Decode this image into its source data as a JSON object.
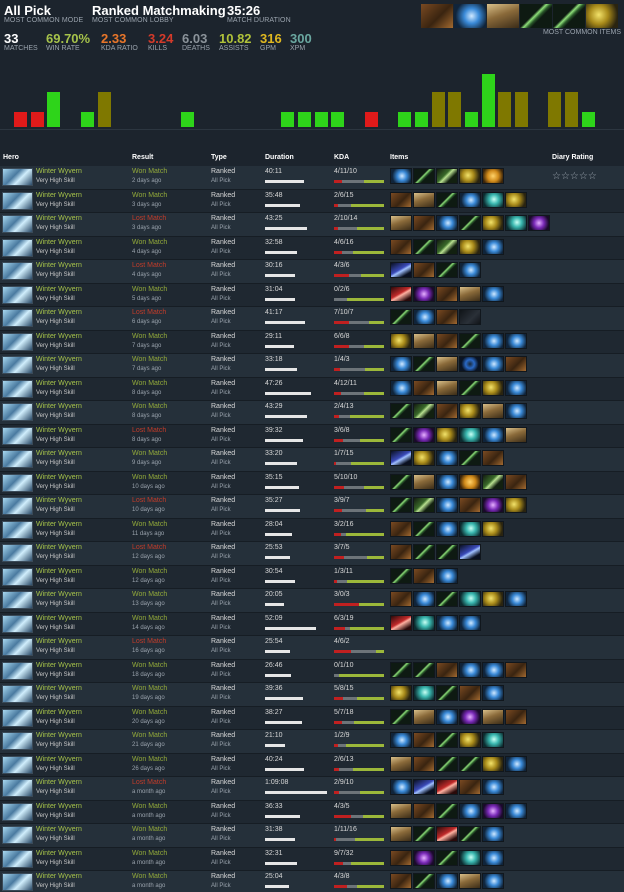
{
  "header": {
    "mode_value": "All Pick",
    "mode_caption": "MOST COMMON MODE",
    "lobby_value": "Ranked Matchmaking",
    "lobby_caption": "MOST COMMON LOBBY",
    "duration_value": "35:26",
    "duration_caption": "MATCH DURATION",
    "stats": [
      {
        "value": "33",
        "caption": "MATCHES",
        "color": "#ffffff"
      },
      {
        "value": "69.70%",
        "caption": "WIN RATE",
        "color": "#a6c34a"
      },
      {
        "value": "2.33",
        "caption": "KDA RATIO",
        "color": "#e8762a"
      },
      {
        "value": "3.24",
        "caption": "KILLS",
        "color": "#d43a2a"
      },
      {
        "value": "6.03",
        "caption": "DEATHS",
        "color": "#8b939a"
      },
      {
        "value": "10.82",
        "caption": "ASSISTS",
        "color": "#b0c23a"
      },
      {
        "value": "316",
        "caption": "GPM",
        "color": "#e0b820"
      },
      {
        "value": "300",
        "caption": "XPM",
        "color": "#6aa7a0"
      }
    ],
    "common_items_caption": "MOST COMMON ITEMS",
    "common_items": [
      "boots-icon",
      "orb-icon",
      "scroll-icon",
      "staff-icon",
      "staff-icon",
      "hammer-icon"
    ]
  },
  "graph": {
    "colors": {
      "win": "#2ed41a",
      "loss": "#e01a1a",
      "neutral": "#7f7800"
    },
    "bars": [
      {
        "level": 0.25,
        "kind": "loss"
      },
      {
        "level": 0.25,
        "kind": "loss"
      },
      {
        "level": 0.58,
        "kind": "win"
      },
      {
        "level": 0,
        "kind": "none"
      },
      {
        "level": 0.25,
        "kind": "win"
      },
      {
        "level": 0.58,
        "kind": "neutral"
      },
      {
        "level": 0,
        "kind": "none"
      },
      {
        "level": 0,
        "kind": "none"
      },
      {
        "level": 0,
        "kind": "none"
      },
      {
        "level": 0,
        "kind": "none"
      },
      {
        "level": 0.25,
        "kind": "win"
      },
      {
        "level": 0,
        "kind": "none"
      },
      {
        "level": 0,
        "kind": "none"
      },
      {
        "level": 0,
        "kind": "none"
      },
      {
        "level": 0,
        "kind": "none"
      },
      {
        "level": 0,
        "kind": "none"
      },
      {
        "level": 0.25,
        "kind": "win"
      },
      {
        "level": 0.25,
        "kind": "win"
      },
      {
        "level": 0.25,
        "kind": "win"
      },
      {
        "level": 0.25,
        "kind": "win"
      },
      {
        "level": 0,
        "kind": "none"
      },
      {
        "level": 0.25,
        "kind": "loss"
      },
      {
        "level": 0,
        "kind": "none"
      },
      {
        "level": 0.25,
        "kind": "win"
      },
      {
        "level": 0.25,
        "kind": "win"
      },
      {
        "level": 0.58,
        "kind": "neutral"
      },
      {
        "level": 0.58,
        "kind": "neutral"
      },
      {
        "level": 0.25,
        "kind": "win"
      },
      {
        "level": 0.88,
        "kind": "win"
      },
      {
        "level": 0.58,
        "kind": "neutral"
      },
      {
        "level": 0.58,
        "kind": "neutral"
      },
      {
        "level": 0,
        "kind": "none"
      },
      {
        "level": 0.58,
        "kind": "neutral"
      },
      {
        "level": 0.58,
        "kind": "neutral"
      },
      {
        "level": 0.25,
        "kind": "win"
      }
    ]
  },
  "columns": {
    "hero": "Hero",
    "result": "Result",
    "type": "Type",
    "duration": "Duration",
    "kda": "KDA",
    "items": "Items",
    "rating": "Diary Rating"
  },
  "rating_stars": "☆☆☆☆☆",
  "matches": [
    {
      "hero": "Winter Wyvern",
      "skill": "Very High Skill",
      "result": "Won Match",
      "win": true,
      "ago": "2 days ago",
      "type": "Ranked",
      "mode": "All Pick",
      "duration": "40:11",
      "dur_frac": 0.63,
      "kda": "4/11/10",
      "k": 4,
      "d": 11,
      "a": 10,
      "items": [
        "orb-icon",
        "staff-icon",
        "branch-icon",
        "hammer-icon",
        "gold-icon"
      ]
    },
    {
      "hero": "Winter Wyvern",
      "skill": "Very High Skill",
      "result": "Won Match",
      "win": true,
      "ago": "3 days ago",
      "type": "Ranked",
      "mode": "All Pick",
      "duration": "35:48",
      "dur_frac": 0.56,
      "kda": "2/6/15",
      "k": 2,
      "d": 6,
      "a": 15,
      "items": [
        "boots-icon",
        "scroll-icon",
        "staff-icon",
        "orb-icon",
        "cyclone-icon",
        "hammer-icon"
      ]
    },
    {
      "hero": "Winter Wyvern",
      "skill": "Very High Skill",
      "result": "Lost Match",
      "win": false,
      "ago": "3 days ago",
      "type": "Ranked",
      "mode": "All Pick",
      "duration": "43:25",
      "dur_frac": 0.68,
      "kda": "2/10/14",
      "k": 2,
      "d": 10,
      "a": 14,
      "items": [
        "scroll-icon",
        "boots-icon",
        "orb-icon",
        "staff-icon",
        "hammer-icon",
        "cyclone-icon",
        "gem-icon"
      ]
    },
    {
      "hero": "Winter Wyvern",
      "skill": "Very High Skill",
      "result": "Won Match",
      "win": true,
      "ago": "4 days ago",
      "type": "Ranked",
      "mode": "All Pick",
      "duration": "32:58",
      "dur_frac": 0.52,
      "kda": "4/6/16",
      "k": 4,
      "d": 6,
      "a": 16,
      "items": [
        "boots-icon",
        "staff-icon",
        "branch-icon",
        "hammer-icon",
        "orb-icon"
      ]
    },
    {
      "hero": "Winter Wyvern",
      "skill": "Very High Skill",
      "result": "Lost Match",
      "win": false,
      "ago": "4 days ago",
      "type": "Ranked",
      "mode": "All Pick",
      "duration": "30:16",
      "dur_frac": 0.48,
      "kda": "4/3/6",
      "k": 4,
      "d": 3,
      "a": 6,
      "items": [
        "claw-icon",
        "boots-icon",
        "staff-icon",
        "orb-icon"
      ]
    },
    {
      "hero": "Winter Wyvern",
      "skill": "Very High Skill",
      "result": "Won Match",
      "win": true,
      "ago": "5 days ago",
      "type": "Ranked",
      "mode": "All Pick",
      "duration": "31:04",
      "dur_frac": 0.49,
      "kda": "0/2/6",
      "k": 0,
      "d": 2,
      "a": 6,
      "items": [
        "blade-icon",
        "gem-icon",
        "boots-icon",
        "scroll-icon",
        "orb-icon"
      ]
    },
    {
      "hero": "Winter Wyvern",
      "skill": "Very High Skill",
      "result": "Lost Match",
      "win": false,
      "ago": "6 days ago",
      "type": "Ranked",
      "mode": "All Pick",
      "duration": "41:17",
      "dur_frac": 0.65,
      "kda": "7/10/7",
      "k": 7,
      "d": 10,
      "a": 7,
      "items": [
        "staff-icon",
        "orb-icon",
        "boots-icon",
        "dark-icon"
      ]
    },
    {
      "hero": "Winter Wyvern",
      "skill": "Very High Skill",
      "result": "Won Match",
      "win": true,
      "ago": "7 days ago",
      "type": "Ranked",
      "mode": "All Pick",
      "duration": "29:11",
      "dur_frac": 0.46,
      "kda": "6/6/8",
      "k": 6,
      "d": 6,
      "a": 8,
      "items": [
        "hammer-icon",
        "scroll-icon",
        "boots-icon",
        "staff-icon",
        "orb-icon",
        "orb-icon"
      ]
    },
    {
      "hero": "Winter Wyvern",
      "skill": "Very High Skill",
      "result": "Won Match",
      "win": true,
      "ago": "7 days ago",
      "type": "Ranked",
      "mode": "All Pick",
      "duration": "33:18",
      "dur_frac": 0.52,
      "kda": "1/4/3",
      "k": 1,
      "d": 4,
      "a": 3,
      "items": [
        "orb-icon",
        "staff-icon",
        "scroll-icon",
        "ring-icon",
        "orb-icon",
        "boots-icon"
      ]
    },
    {
      "hero": "Winter Wyvern",
      "skill": "Very High Skill",
      "result": "Won Match",
      "win": true,
      "ago": "8 days ago",
      "type": "Ranked",
      "mode": "All Pick",
      "duration": "47:26",
      "dur_frac": 0.74,
      "kda": "4/12/11",
      "k": 4,
      "d": 12,
      "a": 11,
      "items": [
        "orb-icon",
        "boots-icon",
        "scroll-icon",
        "staff-icon",
        "hammer-icon",
        "orb-icon"
      ]
    },
    {
      "hero": "Winter Wyvern",
      "skill": "Very High Skill",
      "result": "Won Match",
      "win": true,
      "ago": "8 days ago",
      "type": "Ranked",
      "mode": "All Pick",
      "duration": "43:29",
      "dur_frac": 0.68,
      "kda": "2/4/13",
      "k": 2,
      "d": 4,
      "a": 13,
      "items": [
        "staff-icon",
        "branch-icon",
        "boots-icon",
        "hammer-icon",
        "scroll-icon",
        "orb-icon"
      ]
    },
    {
      "hero": "Winter Wyvern",
      "skill": "Very High Skill",
      "result": "Lost Match",
      "win": false,
      "ago": "8 days ago",
      "type": "Ranked",
      "mode": "All Pick",
      "duration": "39:32",
      "dur_frac": 0.62,
      "kda": "3/6/8",
      "k": 3,
      "d": 6,
      "a": 8,
      "items": [
        "staff-icon",
        "gem-icon",
        "hammer-icon",
        "cyclone-icon",
        "orb-icon",
        "scroll-icon"
      ]
    },
    {
      "hero": "Winter Wyvern",
      "skill": "Very High Skill",
      "result": "Won Match",
      "win": true,
      "ago": "9 days ago",
      "type": "Ranked",
      "mode": "All Pick",
      "duration": "33:20",
      "dur_frac": 0.52,
      "kda": "1/7/15",
      "k": 1,
      "d": 7,
      "a": 15,
      "items": [
        "claw-icon",
        "hammer-icon",
        "orb-icon",
        "staff-icon",
        "boots-icon"
      ]
    },
    {
      "hero": "Winter Wyvern",
      "skill": "Very High Skill",
      "result": "Won Match",
      "win": true,
      "ago": "10 days ago",
      "type": "Ranked",
      "mode": "All Pick",
      "duration": "35:15",
      "dur_frac": 0.55,
      "kda": "5/10/10",
      "k": 5,
      "d": 10,
      "a": 10,
      "items": [
        "staff-icon",
        "scroll-icon",
        "orb-icon",
        "gold-icon",
        "branch-icon",
        "boots-icon"
      ]
    },
    {
      "hero": "Winter Wyvern",
      "skill": "Very High Skill",
      "result": "Lost Match",
      "win": false,
      "ago": "10 days ago",
      "type": "Ranked",
      "mode": "All Pick",
      "duration": "35:27",
      "dur_frac": 0.56,
      "kda": "3/9/7",
      "k": 3,
      "d": 9,
      "a": 7,
      "items": [
        "staff-icon",
        "branch-icon",
        "orb-icon",
        "boots-icon",
        "gem-icon",
        "hammer-icon"
      ]
    },
    {
      "hero": "Winter Wyvern",
      "skill": "Very High Skill",
      "result": "Won Match",
      "win": true,
      "ago": "11 days ago",
      "type": "Ranked",
      "mode": "All Pick",
      "duration": "28:04",
      "dur_frac": 0.44,
      "kda": "3/2/16",
      "k": 3,
      "d": 2,
      "a": 16,
      "items": [
        "boots-icon",
        "staff-icon",
        "orb-icon",
        "cyclone-icon",
        "hammer-icon"
      ]
    },
    {
      "hero": "Winter Wyvern",
      "skill": "Very High Skill",
      "result": "Lost Match",
      "win": false,
      "ago": "12 days ago",
      "type": "Ranked",
      "mode": "All Pick",
      "duration": "25:53",
      "dur_frac": 0.4,
      "kda": "3/7/5",
      "k": 3,
      "d": 7,
      "a": 5,
      "items": [
        "boots-icon",
        "staff-icon",
        "staff-icon",
        "claw-icon"
      ]
    },
    {
      "hero": "Winter Wyvern",
      "skill": "Very High Skill",
      "result": "Won Match",
      "win": true,
      "ago": "12 days ago",
      "type": "Ranked",
      "mode": "All Pick",
      "duration": "30:54",
      "dur_frac": 0.48,
      "kda": "1/3/11",
      "k": 1,
      "d": 3,
      "a": 11,
      "items": [
        "staff-icon",
        "boots-icon",
        "orb-icon"
      ]
    },
    {
      "hero": "Winter Wyvern",
      "skill": "Very High Skill",
      "result": "Won Match",
      "win": true,
      "ago": "13 days ago",
      "type": "Ranked",
      "mode": "All Pick",
      "duration": "20:05",
      "dur_frac": 0.31,
      "kda": "3/0/3",
      "k": 3,
      "d": 0,
      "a": 3,
      "items": [
        "boots-icon",
        "orb-icon",
        "staff-icon",
        "cyclone-icon",
        "hammer-icon",
        "orb-icon"
      ]
    },
    {
      "hero": "Winter Wyvern",
      "skill": "Very High Skill",
      "result": "Won Match",
      "win": true,
      "ago": "14 days ago",
      "type": "Ranked",
      "mode": "All Pick",
      "duration": "52:09",
      "dur_frac": 0.82,
      "kda": "6/3/19",
      "k": 6,
      "d": 3,
      "a": 19,
      "items": [
        "blade-icon",
        "cyclone-icon",
        "orb-icon",
        "orb-icon"
      ]
    },
    {
      "hero": "Winter Wyvern",
      "skill": "Very High Skill",
      "result": "Lost Match",
      "win": false,
      "ago": "16 days ago",
      "type": "Ranked",
      "mode": "All Pick",
      "duration": "25:54",
      "dur_frac": 0.4,
      "kda": "4/6/2",
      "k": 4,
      "d": 6,
      "a": 2,
      "items": []
    },
    {
      "hero": "Winter Wyvern",
      "skill": "Very High Skill",
      "result": "Won Match",
      "win": true,
      "ago": "18 days ago",
      "type": "Ranked",
      "mode": "All Pick",
      "duration": "26:46",
      "dur_frac": 0.42,
      "kda": "0/1/10",
      "k": 0,
      "d": 1,
      "a": 10,
      "items": [
        "staff-icon",
        "staff-icon",
        "boots-icon",
        "orb-icon",
        "orb-icon",
        "boots-icon"
      ]
    },
    {
      "hero": "Winter Wyvern",
      "skill": "Very High Skill",
      "result": "Won Match",
      "win": true,
      "ago": "19 days ago",
      "type": "Ranked",
      "mode": "All Pick",
      "duration": "39:36",
      "dur_frac": 0.62,
      "kda": "5/8/15",
      "k": 5,
      "d": 8,
      "a": 15,
      "items": [
        "hammer-icon",
        "cyclone-icon",
        "staff-icon",
        "boots-icon",
        "orb-icon"
      ]
    },
    {
      "hero": "Winter Wyvern",
      "skill": "Very High Skill",
      "result": "Won Match",
      "win": true,
      "ago": "20 days ago",
      "type": "Ranked",
      "mode": "All Pick",
      "duration": "38:27",
      "dur_frac": 0.6,
      "kda": "5/7/18",
      "k": 5,
      "d": 7,
      "a": 18,
      "items": [
        "staff-icon",
        "scroll-icon",
        "orb-icon",
        "gem-icon",
        "scroll-icon",
        "boots-icon"
      ]
    },
    {
      "hero": "Winter Wyvern",
      "skill": "Very High Skill",
      "result": "Won Match",
      "win": true,
      "ago": "21 days ago",
      "type": "Ranked",
      "mode": "All Pick",
      "duration": "21:10",
      "dur_frac": 0.33,
      "kda": "1/2/9",
      "k": 1,
      "d": 2,
      "a": 9,
      "items": [
        "orb-icon",
        "boots-icon",
        "staff-icon",
        "hammer-icon",
        "cyclone-icon"
      ]
    },
    {
      "hero": "Winter Wyvern",
      "skill": "Very High Skill",
      "result": "Won Match",
      "win": true,
      "ago": "26 days ago",
      "type": "Ranked",
      "mode": "All Pick",
      "duration": "40:24",
      "dur_frac": 0.63,
      "kda": "2/6/13",
      "k": 2,
      "d": 6,
      "a": 13,
      "items": [
        "scroll-icon",
        "boots-icon",
        "staff-icon",
        "staff-icon",
        "hammer-icon",
        "orb-icon"
      ]
    },
    {
      "hero": "Winter Wyvern",
      "skill": "Very High Skill",
      "result": "Lost Match",
      "win": false,
      "ago": "a month ago",
      "type": "Ranked",
      "mode": "All Pick",
      "duration": "1:09:08",
      "dur_frac": 1.0,
      "kda": "2/9/10",
      "k": 2,
      "d": 9,
      "a": 10,
      "items": [
        "orb-icon",
        "claw-icon",
        "blade-icon",
        "boots-icon",
        "orb-icon"
      ]
    },
    {
      "hero": "Winter Wyvern",
      "skill": "Very High Skill",
      "result": "Won Match",
      "win": true,
      "ago": "a month ago",
      "type": "Ranked",
      "mode": "All Pick",
      "duration": "36:33",
      "dur_frac": 0.57,
      "kda": "4/3/5",
      "k": 4,
      "d": 3,
      "a": 5,
      "items": [
        "scroll-icon",
        "boots-icon",
        "staff-icon",
        "orb-icon",
        "gem-icon",
        "orb-icon"
      ]
    },
    {
      "hero": "Winter Wyvern",
      "skill": "Very High Skill",
      "result": "Won Match",
      "win": true,
      "ago": "a month ago",
      "type": "Ranked",
      "mode": "All Pick",
      "duration": "31:38",
      "dur_frac": 0.49,
      "kda": "1/11/16",
      "k": 1,
      "d": 11,
      "a": 16,
      "items": [
        "scroll-icon",
        "staff-icon",
        "blade-icon",
        "staff-icon",
        "orb-icon"
      ]
    },
    {
      "hero": "Winter Wyvern",
      "skill": "Very High Skill",
      "result": "Won Match",
      "win": true,
      "ago": "a month ago",
      "type": "Ranked",
      "mode": "All Pick",
      "duration": "32:31",
      "dur_frac": 0.51,
      "kda": "9/7/32",
      "k": 9,
      "d": 7,
      "a": 32,
      "items": [
        "boots-icon",
        "gem-icon",
        "staff-icon",
        "cyclone-icon",
        "orb-icon"
      ]
    },
    {
      "hero": "Winter Wyvern",
      "skill": "Very High Skill",
      "result": "Won Match",
      "win": true,
      "ago": "a month ago",
      "type": "Ranked",
      "mode": "All Pick",
      "duration": "25:04",
      "dur_frac": 0.39,
      "kda": "4/3/8",
      "k": 4,
      "d": 3,
      "a": 8,
      "items": [
        "boots-icon",
        "staff-icon",
        "orb-icon",
        "scroll-icon",
        "orb-icon"
      ]
    }
  ]
}
